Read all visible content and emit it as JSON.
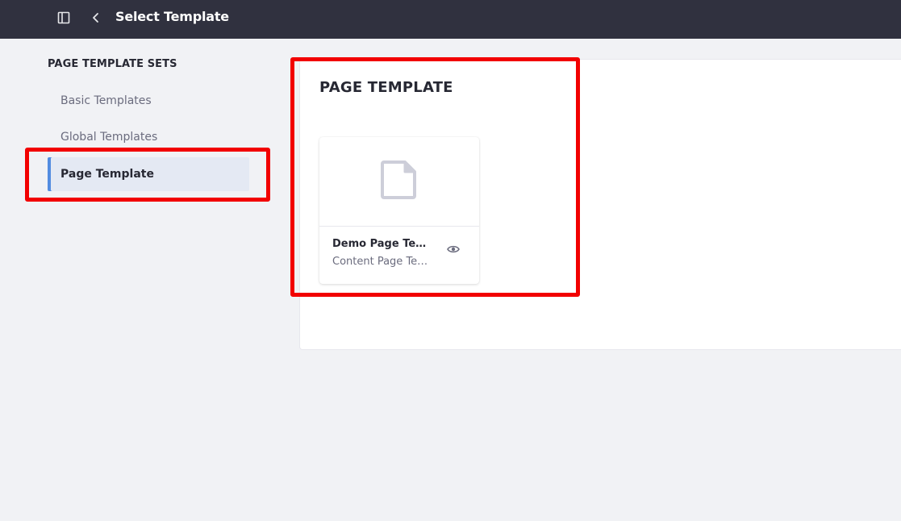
{
  "header": {
    "title": "Select Template",
    "panel_toggle_icon": "sidebar-panel-icon",
    "back_icon": "chevron-left-icon"
  },
  "sidebar": {
    "heading": "PAGE TEMPLATE SETS",
    "items": [
      {
        "label": "Basic Templates",
        "active": false
      },
      {
        "label": "Global Templates",
        "active": false
      },
      {
        "label": "Page Template",
        "active": true
      }
    ]
  },
  "main": {
    "title": "PAGE TEMPLATE",
    "cards": [
      {
        "title": "Demo Page Template",
        "subtitle": "Content Page Template",
        "preview_icon": "page-document-icon",
        "action_icon": "eye-icon"
      }
    ]
  },
  "colors": {
    "header_bg": "#30313f",
    "page_bg": "#f1f2f5",
    "active_nav_bg": "#e4e9f3",
    "active_nav_accent": "#528ce0",
    "highlight_box": "#f20000"
  }
}
